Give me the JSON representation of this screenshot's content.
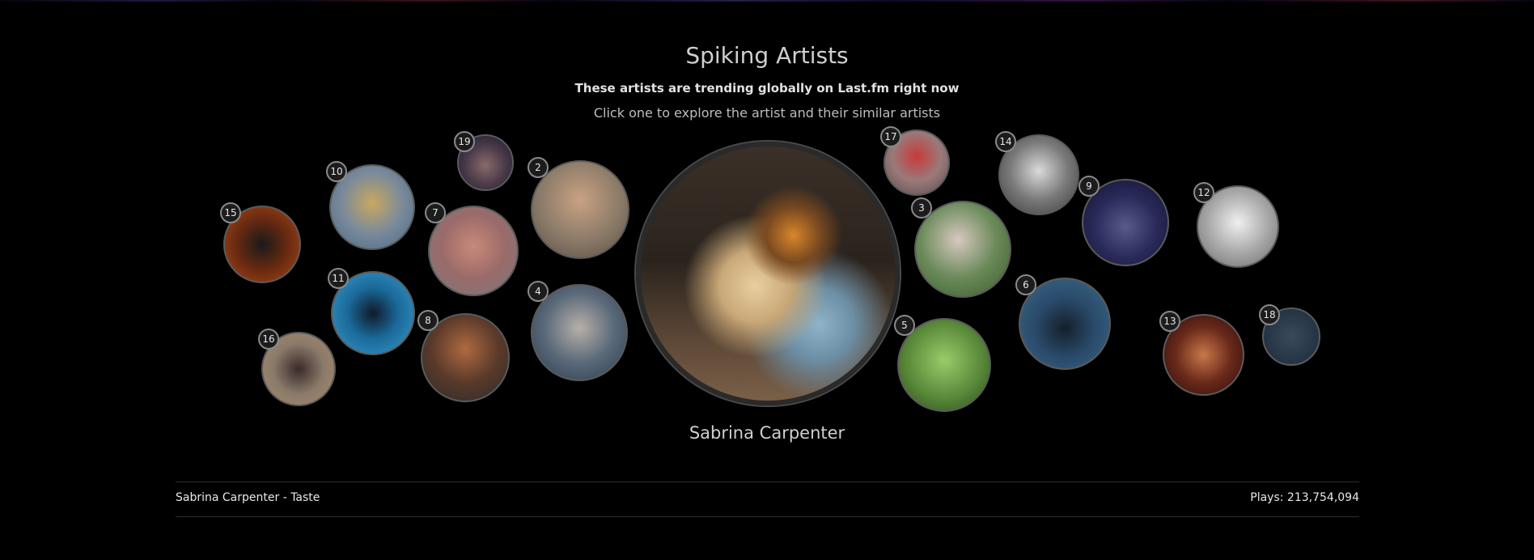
{
  "header": {
    "title": "Spiking Artists",
    "subtitle": "These artists are trending globally on Last.fm right now",
    "hint": "Click one to explore the artist and their similar artists"
  },
  "featured": {
    "name": "Sabrina Carpenter"
  },
  "artists": [
    {
      "rank": "2",
      "color": "#8a7a68"
    },
    {
      "rank": "3",
      "color": "#4a6a3a"
    },
    {
      "rank": "4",
      "color": "#3a4a5a"
    },
    {
      "rank": "5",
      "color": "#6a9a4a"
    },
    {
      "rank": "6",
      "color": "#2a4a6a"
    },
    {
      "rank": "7",
      "color": "#8a5a5a"
    },
    {
      "rank": "8",
      "color": "#5a3a2a"
    },
    {
      "rank": "9",
      "color": "#2a2a5a"
    },
    {
      "rank": "10",
      "color": "#7a8a9a"
    },
    {
      "rank": "11",
      "color": "#1a6a9a"
    },
    {
      "rank": "12",
      "color": "#9a9a9a"
    },
    {
      "rank": "13",
      "color": "#6a2a1a"
    },
    {
      "rank": "14",
      "color": "#7a7a7a"
    },
    {
      "rank": "15",
      "color": "#6a2a10"
    },
    {
      "rank": "16",
      "color": "#8a7a6a"
    },
    {
      "rank": "17",
      "color": "#9a7a7a"
    },
    {
      "rank": "18",
      "color": "#2a3a4a"
    },
    {
      "rank": "19",
      "color": "#4a3a4a"
    }
  ],
  "footer": {
    "track": "Sabrina Carpenter - Taste",
    "plays": "Plays: 213,754,094"
  }
}
